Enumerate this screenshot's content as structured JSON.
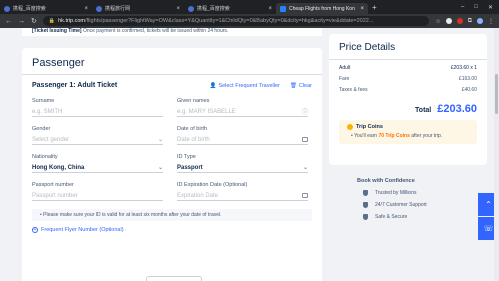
{
  "browser": {
    "tabs": [
      {
        "label": "携程_百度搜索",
        "active": false
      },
      {
        "label": "携程旅行网",
        "active": false
      },
      {
        "label": "携程_百度搜索",
        "active": false
      },
      {
        "label": "Cheap Flights from Hong Kon",
        "active": true
      }
    ],
    "new_tab": "+",
    "url_host": "hk.trip.com",
    "url_path": "/flights/passenger?FlightWay=OW&class=Y&Quantity=1&ChildQty=0&BabyQty=0&dcity=hkg&acity=vie&ddate=2022..."
  },
  "notice": {
    "bold": "[Ticket Issuing Time]",
    "text": " Once payment is confirmed, tickets will be issued within 24 hours."
  },
  "passenger": {
    "title": "Passenger",
    "subtitle": "Passenger 1: Adult Ticket",
    "select_frequent": "Select Frequent Traveller",
    "clear": "Clear",
    "surname_label": "Surname",
    "surname_placeholder": "e.g. SMITH",
    "given_label": "Given names",
    "given_placeholder": "e.g. MARY ISABELLE",
    "gender_label": "Gender",
    "gender_placeholder": "Select gender",
    "dob_label": "Date of birth",
    "dob_placeholder": "Date of birth",
    "nationality_label": "Nationality",
    "nationality_value": "Hong Kong, China",
    "idtype_label": "ID Type",
    "idtype_value": "Passport",
    "passport_label": "Passport number",
    "passport_placeholder": "Passport number",
    "expiry_label": "ID Expiration Date (Optional)",
    "expiry_placeholder": "Expiration Date",
    "hint": "Please make sure your ID is valid for at least six months after your date of travel.",
    "frequent_flyer": "Frequent Flyer Number (Optional)"
  },
  "price": {
    "title": "Price Details",
    "rows": [
      {
        "label": "Adult",
        "value": "£203.60 x 1"
      },
      {
        "label": "Fare",
        "value": "£163.00"
      },
      {
        "label": "Taxes & fees",
        "value": "£40.60"
      }
    ],
    "total_label": "Total",
    "total_value": "£203.60",
    "coins_title": "Trip Coins",
    "coins_pre": "You'll earn ",
    "coins_amount": "70 Trip Coins",
    "coins_post": " after your trip."
  },
  "confidence": {
    "title": "Book with Confidence",
    "items": [
      "Trusted by Millions",
      "24/7 Customer Support",
      "Safe & Secure"
    ]
  },
  "colors": {
    "accent": "#3264ff",
    "text": "#0f294d",
    "coin": "#f7b500"
  }
}
